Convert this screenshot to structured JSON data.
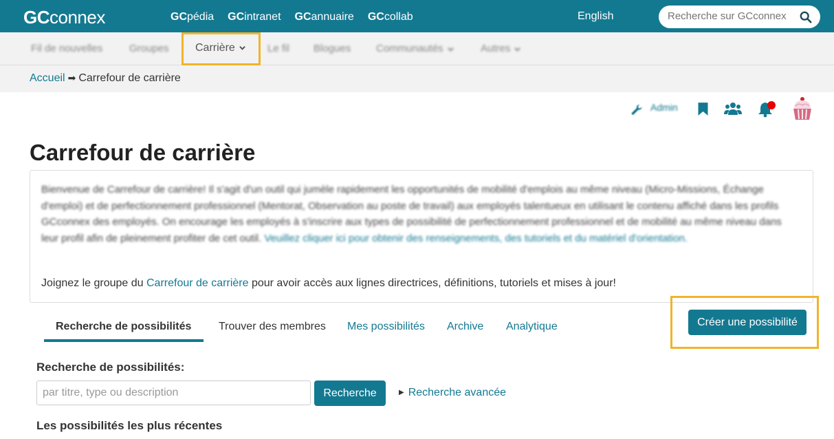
{
  "topbar": {
    "logo_bold": "GC",
    "logo_rest": "connex",
    "links": [
      {
        "bold": "GC",
        "rest": "pédia"
      },
      {
        "bold": "GC",
        "rest": "intranet"
      },
      {
        "bold": "GC",
        "rest": "annuaire"
      },
      {
        "bold": "GC",
        "rest": "collab"
      }
    ],
    "language": "English",
    "search_placeholder": "Recherche sur GCconnex"
  },
  "nav": {
    "items": [
      "Fil de nouvelles",
      "Groupes",
      "Carrière",
      "Le fil",
      "Blogues",
      "Communautés",
      "Autres"
    ]
  },
  "breadcrumb": {
    "home": "Accueil",
    "current": "Carrefour de carrière"
  },
  "tools": {
    "admin_label": "Admin",
    "icons": [
      "wrench-icon",
      "bookmark-icon",
      "colleagues-icon",
      "notifications-icon",
      "avatar"
    ],
    "notification_color": "#e60000"
  },
  "page": {
    "title": "Carrefour de carrière"
  },
  "intro": {
    "paragraph": "Bienvenue de Carrefour de carrière! Il s'agit d'un outil qui jumèle rapidement les opportunités de mobilité d'emplois au même niveau (Micro-Missions, Échange d'emploi) et de perfectionnement professionnel (Mentorat, Observation au poste de travail) aux employés talentueux en utilisant le contenu affiché dans les profils GCconnex des employés. On encourage les employés à s'inscrire aux types de possibilité de perfectionnement professionnel et de mobilité au même niveau dans leur profil afin de pleinement profiter de cet outil.",
    "paragraph_link": "Veuillez cliquer ici pour obtenir des renseignements, des tutoriels et du matériel d'orientation.",
    "join_before": "Joignez le groupe du ",
    "join_link": "Carrefour de carrière",
    "join_after": " pour avoir accès aux lignes directrices, définitions, tutoriels et mises à jour!"
  },
  "tabs": [
    "Recherche de possibilités",
    "Trouver des membres",
    "Mes possibilités",
    "Archive",
    "Analytique"
  ],
  "create_button": "Créer une possibilité",
  "search": {
    "label": "Recherche de possibilités:",
    "placeholder": "par titre, type ou description",
    "button": "Recherche",
    "advanced": "Recherche avancée"
  },
  "recent_heading": "Les possibilités les plus récentes",
  "colors": {
    "brand": "#137991",
    "highlight": "#f0b429"
  }
}
